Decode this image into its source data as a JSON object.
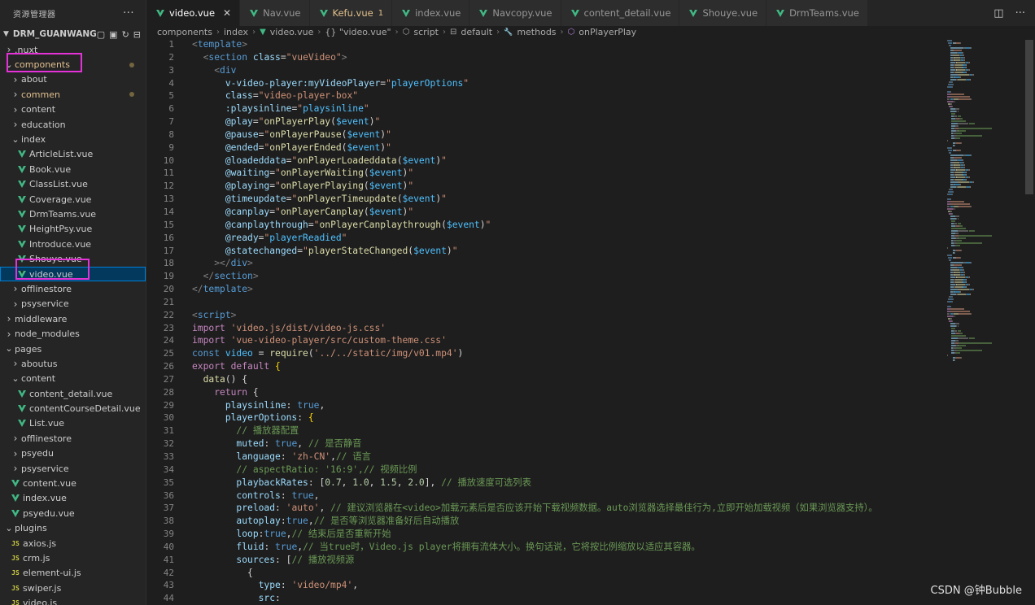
{
  "sidebar": {
    "title": "资源管理器",
    "more": "···",
    "root_label": "DRM_GUANWANG",
    "items": [
      {
        "label": ".nuxt",
        "depth": 0,
        "kind": "folder",
        "open": false
      },
      {
        "label": "components",
        "depth": 0,
        "kind": "folder",
        "open": true,
        "modified": true
      },
      {
        "label": "about",
        "depth": 1,
        "kind": "folder",
        "open": false
      },
      {
        "label": "commen",
        "depth": 1,
        "kind": "folder",
        "open": false,
        "modified": true
      },
      {
        "label": "content",
        "depth": 1,
        "kind": "folder",
        "open": false
      },
      {
        "label": "education",
        "depth": 1,
        "kind": "folder",
        "open": false
      },
      {
        "label": "index",
        "depth": 1,
        "kind": "folder",
        "open": true
      },
      {
        "label": "ArticleList.vue",
        "depth": 2,
        "kind": "vue"
      },
      {
        "label": "Book.vue",
        "depth": 2,
        "kind": "vue"
      },
      {
        "label": "ClassList.vue",
        "depth": 2,
        "kind": "vue"
      },
      {
        "label": "Coverage.vue",
        "depth": 2,
        "kind": "vue"
      },
      {
        "label": "DrmTeams.vue",
        "depth": 2,
        "kind": "vue"
      },
      {
        "label": "HeightPsy.vue",
        "depth": 2,
        "kind": "vue"
      },
      {
        "label": "Introduce.vue",
        "depth": 2,
        "kind": "vue"
      },
      {
        "label": "Shouye.vue",
        "depth": 2,
        "kind": "vue"
      },
      {
        "label": "video.vue",
        "depth": 2,
        "kind": "vue",
        "selected": true
      },
      {
        "label": "offlinestore",
        "depth": 1,
        "kind": "folder",
        "open": false
      },
      {
        "label": "psyservice",
        "depth": 1,
        "kind": "folder",
        "open": false
      },
      {
        "label": "middleware",
        "depth": 0,
        "kind": "folder",
        "open": false
      },
      {
        "label": "node_modules",
        "depth": 0,
        "kind": "folder",
        "open": false
      },
      {
        "label": "pages",
        "depth": 0,
        "kind": "folder",
        "open": true
      },
      {
        "label": "aboutus",
        "depth": 1,
        "kind": "folder",
        "open": false
      },
      {
        "label": "content",
        "depth": 1,
        "kind": "folder",
        "open": true
      },
      {
        "label": "content_detail.vue",
        "depth": 2,
        "kind": "vue"
      },
      {
        "label": "contentCourseDetail.vue",
        "depth": 2,
        "kind": "vue"
      },
      {
        "label": "List.vue",
        "depth": 2,
        "kind": "vue"
      },
      {
        "label": "offlinestore",
        "depth": 1,
        "kind": "folder",
        "open": false
      },
      {
        "label": "psyedu",
        "depth": 1,
        "kind": "folder",
        "open": false
      },
      {
        "label": "psyservice",
        "depth": 1,
        "kind": "folder",
        "open": false
      },
      {
        "label": "content.vue",
        "depth": 1,
        "kind": "vue"
      },
      {
        "label": "index.vue",
        "depth": 1,
        "kind": "vue"
      },
      {
        "label": "psyedu.vue",
        "depth": 1,
        "kind": "vue"
      },
      {
        "label": "plugins",
        "depth": 0,
        "kind": "folder",
        "open": true
      },
      {
        "label": "axios.js",
        "depth": 1,
        "kind": "js"
      },
      {
        "label": "crm.js",
        "depth": 1,
        "kind": "js"
      },
      {
        "label": "element-ui.js",
        "depth": 1,
        "kind": "js"
      },
      {
        "label": "swiper.js",
        "depth": 1,
        "kind": "js"
      },
      {
        "label": "video.js",
        "depth": 1,
        "kind": "js"
      }
    ]
  },
  "tabs": [
    {
      "name": "video.vue",
      "active": true
    },
    {
      "name": "Nav.vue"
    },
    {
      "name": "Kefu.vue",
      "modified": true,
      "badge": "1"
    },
    {
      "name": "index.vue"
    },
    {
      "name": "Navcopy.vue"
    },
    {
      "name": "content_detail.vue"
    },
    {
      "name": "Shouye.vue"
    },
    {
      "name": "DrmTeams.vue"
    }
  ],
  "breadcrumb": [
    "components",
    "index",
    "video.vue",
    "{} \"video.vue\"",
    "script",
    "default",
    "methods",
    "onPlayerPlay"
  ],
  "code": [
    [
      [
        "tok-ang",
        "<"
      ],
      [
        "tok-tag",
        "template"
      ],
      [
        "tok-ang",
        ">"
      ]
    ],
    [
      [
        "tok-pl",
        "  "
      ],
      [
        "tok-ang",
        "<"
      ],
      [
        "tok-tag",
        "section"
      ],
      [
        "tok-pl",
        " "
      ],
      [
        "tok-attr",
        "class"
      ],
      [
        "tok-pl",
        "="
      ],
      [
        "tok-str",
        "\"vueVideo\""
      ],
      [
        "tok-ang",
        ">"
      ]
    ],
    [
      [
        "tok-pl",
        "    "
      ],
      [
        "tok-ang",
        "<"
      ],
      [
        "tok-tag",
        "div"
      ]
    ],
    [
      [
        "tok-pl",
        "      "
      ],
      [
        "tok-attr",
        "v-video-player:myVideoPlayer"
      ],
      [
        "tok-pl",
        "="
      ],
      [
        "tok-str",
        "\""
      ],
      [
        "tok-var",
        "playerOptions"
      ],
      [
        "tok-str",
        "\""
      ]
    ],
    [
      [
        "tok-pl",
        "      "
      ],
      [
        "tok-attr",
        "class"
      ],
      [
        "tok-pl",
        "="
      ],
      [
        "tok-str",
        "\"video-player-box\""
      ]
    ],
    [
      [
        "tok-pl",
        "      "
      ],
      [
        "tok-attr",
        ":playsinline"
      ],
      [
        "tok-pl",
        "="
      ],
      [
        "tok-str",
        "\""
      ],
      [
        "tok-var",
        "playsinline"
      ],
      [
        "tok-str",
        "\""
      ]
    ],
    [
      [
        "tok-pl",
        "      "
      ],
      [
        "tok-attr",
        "@play"
      ],
      [
        "tok-pl",
        "="
      ],
      [
        "tok-str",
        "\""
      ],
      [
        "tok-fn",
        "onPlayerPlay"
      ],
      [
        "tok-pl",
        "("
      ],
      [
        "tok-var",
        "$event"
      ],
      [
        "tok-pl",
        ")"
      ],
      [
        "tok-str",
        "\""
      ]
    ],
    [
      [
        "tok-pl",
        "      "
      ],
      [
        "tok-attr",
        "@pause"
      ],
      [
        "tok-pl",
        "="
      ],
      [
        "tok-str",
        "\""
      ],
      [
        "tok-fn",
        "onPlayerPause"
      ],
      [
        "tok-pl",
        "("
      ],
      [
        "tok-var",
        "$event"
      ],
      [
        "tok-pl",
        ")"
      ],
      [
        "tok-str",
        "\""
      ]
    ],
    [
      [
        "tok-pl",
        "      "
      ],
      [
        "tok-attr",
        "@ended"
      ],
      [
        "tok-pl",
        "="
      ],
      [
        "tok-str",
        "\""
      ],
      [
        "tok-fn",
        "onPlayerEnded"
      ],
      [
        "tok-pl",
        "("
      ],
      [
        "tok-var",
        "$event"
      ],
      [
        "tok-pl",
        ")"
      ],
      [
        "tok-str",
        "\""
      ]
    ],
    [
      [
        "tok-pl",
        "      "
      ],
      [
        "tok-attr",
        "@loadeddata"
      ],
      [
        "tok-pl",
        "="
      ],
      [
        "tok-str",
        "\""
      ],
      [
        "tok-fn",
        "onPlayerLoadeddata"
      ],
      [
        "tok-pl",
        "("
      ],
      [
        "tok-var",
        "$event"
      ],
      [
        "tok-pl",
        ")"
      ],
      [
        "tok-str",
        "\""
      ]
    ],
    [
      [
        "tok-pl",
        "      "
      ],
      [
        "tok-attr",
        "@waiting"
      ],
      [
        "tok-pl",
        "="
      ],
      [
        "tok-str",
        "\""
      ],
      [
        "tok-fn",
        "onPlayerWaiting"
      ],
      [
        "tok-pl",
        "("
      ],
      [
        "tok-var",
        "$event"
      ],
      [
        "tok-pl",
        ")"
      ],
      [
        "tok-str",
        "\""
      ]
    ],
    [
      [
        "tok-pl",
        "      "
      ],
      [
        "tok-attr",
        "@playing"
      ],
      [
        "tok-pl",
        "="
      ],
      [
        "tok-str",
        "\""
      ],
      [
        "tok-fn",
        "onPlayerPlaying"
      ],
      [
        "tok-pl",
        "("
      ],
      [
        "tok-var",
        "$event"
      ],
      [
        "tok-pl",
        ")"
      ],
      [
        "tok-str",
        "\""
      ]
    ],
    [
      [
        "tok-pl",
        "      "
      ],
      [
        "tok-attr",
        "@timeupdate"
      ],
      [
        "tok-pl",
        "="
      ],
      [
        "tok-str",
        "\""
      ],
      [
        "tok-fn",
        "onPlayerTimeupdate"
      ],
      [
        "tok-pl",
        "("
      ],
      [
        "tok-var",
        "$event"
      ],
      [
        "tok-pl",
        ")"
      ],
      [
        "tok-str",
        "\""
      ]
    ],
    [
      [
        "tok-pl",
        "      "
      ],
      [
        "tok-attr",
        "@canplay"
      ],
      [
        "tok-pl",
        "="
      ],
      [
        "tok-str",
        "\""
      ],
      [
        "tok-fn",
        "onPlayerCanplay"
      ],
      [
        "tok-pl",
        "("
      ],
      [
        "tok-var",
        "$event"
      ],
      [
        "tok-pl",
        ")"
      ],
      [
        "tok-str",
        "\""
      ]
    ],
    [
      [
        "tok-pl",
        "      "
      ],
      [
        "tok-attr",
        "@canplaythrough"
      ],
      [
        "tok-pl",
        "="
      ],
      [
        "tok-str",
        "\""
      ],
      [
        "tok-fn",
        "onPlayerCanplaythrough"
      ],
      [
        "tok-pl",
        "("
      ],
      [
        "tok-var",
        "$event"
      ],
      [
        "tok-pl",
        ")"
      ],
      [
        "tok-str",
        "\""
      ]
    ],
    [
      [
        "tok-pl",
        "      "
      ],
      [
        "tok-attr",
        "@ready"
      ],
      [
        "tok-pl",
        "="
      ],
      [
        "tok-str",
        "\""
      ],
      [
        "tok-var",
        "playerReadied"
      ],
      [
        "tok-str",
        "\""
      ]
    ],
    [
      [
        "tok-pl",
        "      "
      ],
      [
        "tok-attr",
        "@statechanged"
      ],
      [
        "tok-pl",
        "="
      ],
      [
        "tok-str",
        "\""
      ],
      [
        "tok-fn",
        "playerStateChanged"
      ],
      [
        "tok-pl",
        "("
      ],
      [
        "tok-var",
        "$event"
      ],
      [
        "tok-pl",
        ")"
      ],
      [
        "tok-str",
        "\""
      ]
    ],
    [
      [
        "tok-pl",
        "    "
      ],
      [
        "tok-ang",
        "></"
      ],
      [
        "tok-tag",
        "div"
      ],
      [
        "tok-ang",
        ">"
      ]
    ],
    [
      [
        "tok-pl",
        "  "
      ],
      [
        "tok-ang",
        "</"
      ],
      [
        "tok-tag",
        "section"
      ],
      [
        "tok-ang",
        ">"
      ]
    ],
    [
      [
        "tok-ang",
        "</"
      ],
      [
        "tok-tag",
        "template"
      ],
      [
        "tok-ang",
        ">"
      ]
    ],
    [],
    [
      [
        "tok-ang",
        "<"
      ],
      [
        "tok-tag",
        "script"
      ],
      [
        "tok-ang",
        ">"
      ]
    ],
    [
      [
        "tok-kw",
        "import"
      ],
      [
        "tok-pl",
        " "
      ],
      [
        "tok-str",
        "'video.js/dist/video-js.css'"
      ]
    ],
    [
      [
        "tok-kw",
        "import"
      ],
      [
        "tok-pl",
        " "
      ],
      [
        "tok-str",
        "'vue-video-player/src/custom-theme.css'"
      ]
    ],
    [
      [
        "tok-bool",
        "const"
      ],
      [
        "tok-pl",
        " "
      ],
      [
        "tok-var",
        "video"
      ],
      [
        "tok-pl",
        " = "
      ],
      [
        "tok-fn",
        "require"
      ],
      [
        "tok-pl",
        "("
      ],
      [
        "tok-str",
        "'../../static/img/v01.mp4'"
      ],
      [
        "tok-pl",
        ")"
      ]
    ],
    [
      [
        "tok-kw",
        "export"
      ],
      [
        "tok-pl",
        " "
      ],
      [
        "tok-kw",
        "default"
      ],
      [
        "tok-pl",
        " "
      ],
      [
        "tok-br",
        "{"
      ]
    ],
    [
      [
        "tok-pl",
        "  "
      ],
      [
        "tok-fn",
        "data"
      ],
      [
        "tok-pl",
        "() {"
      ]
    ],
    [
      [
        "tok-pl",
        "    "
      ],
      [
        "tok-kw",
        "return"
      ],
      [
        "tok-pl",
        " {"
      ]
    ],
    [
      [
        "tok-pl",
        "      "
      ],
      [
        "tok-prop",
        "playsinline"
      ],
      [
        "tok-pl",
        ": "
      ],
      [
        "tok-bool",
        "true"
      ],
      [
        "tok-pl",
        ","
      ]
    ],
    [
      [
        "tok-pl",
        "      "
      ],
      [
        "tok-prop",
        "playerOptions"
      ],
      [
        "tok-pl",
        ": "
      ],
      [
        "tok-br",
        "{"
      ]
    ],
    [
      [
        "tok-pl",
        "        "
      ],
      [
        "tok-cmt",
        "// 播放器配置"
      ]
    ],
    [
      [
        "tok-pl",
        "        "
      ],
      [
        "tok-prop",
        "muted"
      ],
      [
        "tok-pl",
        ": "
      ],
      [
        "tok-bool",
        "true"
      ],
      [
        "tok-pl",
        ", "
      ],
      [
        "tok-cmt",
        "// 是否静音"
      ]
    ],
    [
      [
        "tok-pl",
        "        "
      ],
      [
        "tok-prop",
        "language"
      ],
      [
        "tok-pl",
        ": "
      ],
      [
        "tok-str",
        "'zh-CN'"
      ],
      [
        "tok-pl",
        ","
      ],
      [
        "tok-cmt",
        "// 语言"
      ]
    ],
    [
      [
        "tok-pl",
        "        "
      ],
      [
        "tok-cmt",
        "// aspectRatio: '16:9',// 视频比例"
      ]
    ],
    [
      [
        "tok-pl",
        "        "
      ],
      [
        "tok-prop",
        "playbackRates"
      ],
      [
        "tok-pl",
        ": ["
      ],
      [
        "tok-num",
        "0.7"
      ],
      [
        "tok-pl",
        ", "
      ],
      [
        "tok-num",
        "1.0"
      ],
      [
        "tok-pl",
        ", "
      ],
      [
        "tok-num",
        "1.5"
      ],
      [
        "tok-pl",
        ", "
      ],
      [
        "tok-num",
        "2.0"
      ],
      [
        "tok-pl",
        "], "
      ],
      [
        "tok-cmt",
        "// 播放速度可选列表"
      ]
    ],
    [
      [
        "tok-pl",
        "        "
      ],
      [
        "tok-prop",
        "controls"
      ],
      [
        "tok-pl",
        ": "
      ],
      [
        "tok-bool",
        "true"
      ],
      [
        "tok-pl",
        ","
      ]
    ],
    [
      [
        "tok-pl",
        "        "
      ],
      [
        "tok-prop",
        "preload"
      ],
      [
        "tok-pl",
        ": "
      ],
      [
        "tok-str",
        "'auto'"
      ],
      [
        "tok-pl",
        ", "
      ],
      [
        "tok-cmt",
        "// 建议浏览器在<video>加载元素后是否应该开始下载视频数据。auto浏览器选择最佳行为,立即开始加载视频（如果浏览器支持）。"
      ]
    ],
    [
      [
        "tok-pl",
        "        "
      ],
      [
        "tok-prop",
        "autoplay"
      ],
      [
        "tok-pl",
        ":"
      ],
      [
        "tok-bool",
        "true"
      ],
      [
        "tok-pl",
        ","
      ],
      [
        "tok-cmt",
        "// 是否等浏览器准备好后自动播放"
      ]
    ],
    [
      [
        "tok-pl",
        "        "
      ],
      [
        "tok-prop",
        "loop"
      ],
      [
        "tok-pl",
        ":"
      ],
      [
        "tok-bool",
        "true"
      ],
      [
        "tok-pl",
        ","
      ],
      [
        "tok-cmt",
        "// 结束后是否重新开始"
      ]
    ],
    [
      [
        "tok-pl",
        "        "
      ],
      [
        "tok-prop",
        "fluid"
      ],
      [
        "tok-pl",
        ": "
      ],
      [
        "tok-bool",
        "true"
      ],
      [
        "tok-pl",
        ","
      ],
      [
        "tok-cmt",
        "// 当true时，Video.js player将拥有流体大小。换句话说，它将按比例缩放以适应其容器。"
      ]
    ],
    [
      [
        "tok-pl",
        "        "
      ],
      [
        "tok-prop",
        "sources"
      ],
      [
        "tok-pl",
        ": ["
      ],
      [
        "tok-cmt",
        "// 播放视频源"
      ]
    ],
    [
      [
        "tok-pl",
        "          {"
      ]
    ],
    [
      [
        "tok-pl",
        "            "
      ],
      [
        "tok-prop",
        "type"
      ],
      [
        "tok-pl",
        ": "
      ],
      [
        "tok-str",
        "'video/mp4'"
      ],
      [
        "tok-pl",
        ","
      ]
    ],
    [
      [
        "tok-pl",
        "            "
      ],
      [
        "tok-prop",
        "src"
      ],
      [
        "tok-pl",
        ":"
      ]
    ]
  ],
  "watermark": "CSDN @钟Bubble",
  "icons": {
    "folder_closed": "chevron-right-icon",
    "folder_open": "chevron-down-icon",
    "vue": "vue-file-icon",
    "js": "js-file-icon"
  },
  "colors": {
    "accent": "#007fd4",
    "highlight_box": "#e432d8",
    "vue_green": "#41b883",
    "modified": "#e2c08d"
  }
}
